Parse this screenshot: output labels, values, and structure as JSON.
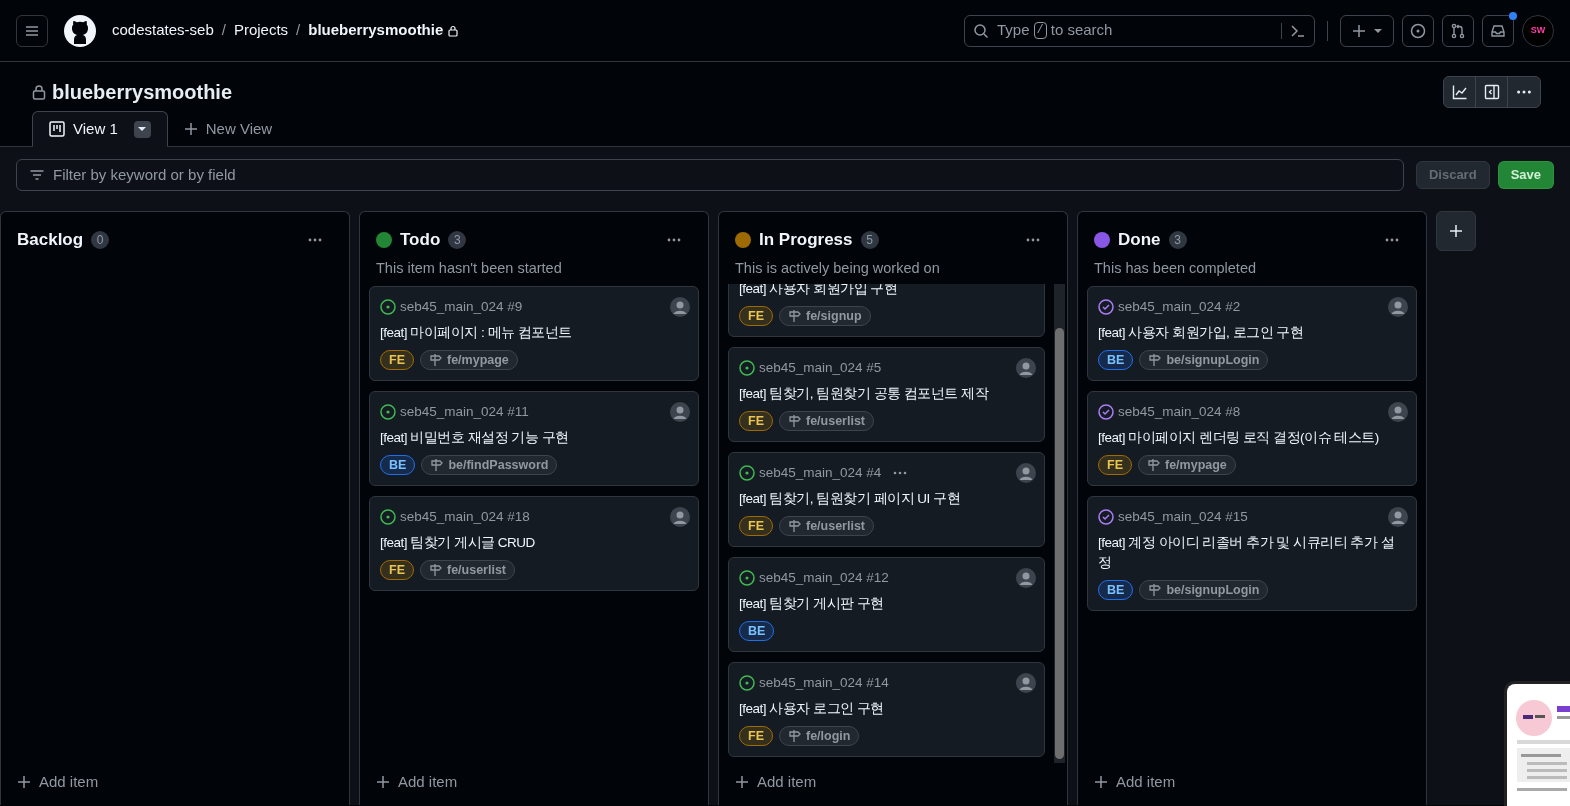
{
  "header": {
    "breadcrumbs": [
      {
        "text": "codestates-seb",
        "current": false
      },
      {
        "text": "Projects",
        "current": false
      },
      {
        "text": "blueberrysmoothie",
        "current": true
      }
    ],
    "separator": "/",
    "search": {
      "placeholder_before": "Type",
      "key": "/",
      "placeholder_after": "to search"
    },
    "avatar": "SW",
    "inbox_unread": true
  },
  "project": {
    "title": "blueberrysmoothie",
    "private": true
  },
  "tabs": [
    {
      "label": "View 1",
      "selected": true
    },
    {
      "label": "New View",
      "selected": false,
      "kind": "new"
    }
  ],
  "filter": {
    "placeholder": "Filter by keyword or by field"
  },
  "buttons": [
    {
      "label": "Discard",
      "disabled": true
    },
    {
      "label": "Save",
      "disabled": false
    }
  ],
  "columns": [
    {
      "name": "Backlog",
      "count": "0",
      "add": "Add item"
    },
    {
      "name": "Todo",
      "color": "#238636",
      "count": "3",
      "description": "This item hasn't been started",
      "add": "Add item",
      "cards": [
        {
          "kind": "full",
          "closed": false,
          "ref": "seb45_main_024 #9",
          "title": "[feat] 마이페이지 : 메뉴 컴포넌트",
          "label": {
            "text": "FE",
            "kind": "fe"
          },
          "branch": "fe/mypage"
        },
        {
          "kind": "full",
          "closed": false,
          "ref": "seb45_main_024 #11",
          "title": "[feat] 비밀번호 재설정 기능 구현",
          "label": {
            "text": "BE",
            "kind": "be"
          },
          "branch": "be/findPassword"
        },
        {
          "kind": "full",
          "closed": false,
          "ref": "seb45_main_024 #18",
          "title": "[feat] 팀찾기 게시글 CRUD",
          "label": {
            "text": "FE",
            "kind": "fe"
          },
          "branch": "fe/userlist"
        }
      ]
    },
    {
      "name": "In Progress",
      "color": "#9e6a03",
      "count": "5",
      "description": "This is actively being worked on",
      "add": "Add item",
      "scrolled": true,
      "cards": [
        {
          "kind": "partial",
          "title": "[feat] 사용자 회원가입 구현",
          "label": {
            "text": "FE",
            "kind": "fe"
          },
          "branch": "fe/signup"
        },
        {
          "kind": "full",
          "closed": false,
          "ref": "seb45_main_024 #5",
          "title": "[feat] 팀찾기, 팀원찾기 공통 컴포넌트 제작",
          "label": {
            "text": "FE",
            "kind": "fe"
          },
          "branch": "fe/userlist"
        },
        {
          "kind": "full",
          "closed": false,
          "ref": "seb45_main_024 #4",
          "hovered": true,
          "title": "[feat] 팀찾기, 팀원찾기 페이지 UI 구현",
          "label": {
            "text": "FE",
            "kind": "fe"
          },
          "branch": "fe/userlist"
        },
        {
          "kind": "full",
          "closed": false,
          "ref": "seb45_main_024 #12",
          "title": "[feat] 팀찾기 게시판 구현",
          "label": {
            "text": "BE",
            "kind": "be"
          }
        },
        {
          "kind": "full",
          "closed": false,
          "ref": "seb45_main_024 #14",
          "title": "[feat] 사용자 로그인 구현",
          "label": {
            "text": "FE",
            "kind": "fe"
          },
          "branch": "fe/login"
        }
      ]
    },
    {
      "name": "Done",
      "color": "#8957e5",
      "count": "3",
      "description": "This has been completed",
      "add": "Add item",
      "cards": [
        {
          "kind": "full",
          "closed": true,
          "ref": "seb45_main_024 #2",
          "title": "[feat] 사용자 회원가입, 로그인 구현",
          "label": {
            "text": "BE",
            "kind": "be"
          },
          "branch": "be/signupLogin"
        },
        {
          "kind": "full",
          "closed": true,
          "ref": "seb45_main_024 #8",
          "title": "[feat] 마이페이지 렌더링 로직 결정(이슈 테스트)",
          "label": {
            "text": "FE",
            "kind": "fe"
          },
          "branch": "fe/mypage"
        },
        {
          "kind": "full",
          "closed": true,
          "ref": "seb45_main_024 #15",
          "title": "[feat] 계정 아이디 리졸버 추가 및 시큐리티 추가 설정",
          "label": {
            "text": "BE",
            "kind": "be"
          },
          "branch": "be/signupLogin"
        }
      ]
    }
  ]
}
